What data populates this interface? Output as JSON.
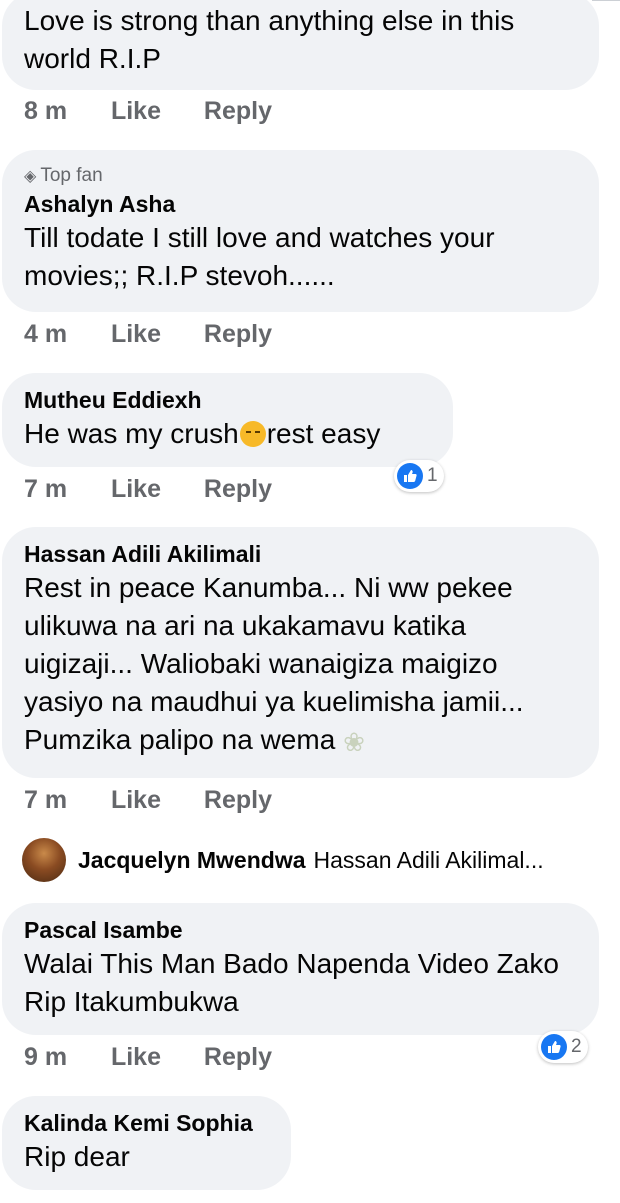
{
  "comments": [
    {
      "text": "Love is strong than anything else in this world R.I.P",
      "time": "8 m",
      "like": "Like",
      "reply": "Reply"
    },
    {
      "badge": "Top fan",
      "name": "Ashalyn Asha",
      "text": "Till todate I still love and watches your movies;; R.I.P stevoh......",
      "time": "4 m",
      "like": "Like",
      "reply": "Reply"
    },
    {
      "name": "Mutheu Eddiexh",
      "text_before": "He was my crush",
      "text_after": "rest easy",
      "time": "7 m",
      "like": "Like",
      "reply": "Reply",
      "reaction_count": "1"
    },
    {
      "name": "Hassan Adili Akilimali",
      "text": "Rest in peace Kanumba... Ni ww pekee ulikuwa na ari na ukakamavu katika uigizaji... Waliobaki wanaigiza maigizo yasiyo na maudhui ya kuelimisha jamii... Pumzika palipo na wema",
      "time": "7 m",
      "like": "Like",
      "reply": "Reply"
    },
    {
      "name": "Pascal Isambe",
      "text": "Walai This Man Bado Napenda Video Zako Rip Itakumbukwa",
      "time": "9 m",
      "like": "Like",
      "reply": "Reply",
      "reaction_count": "2"
    },
    {
      "name": "Kalinda Kemi Sophia",
      "text": "Rip dear"
    }
  ],
  "reply_preview": {
    "name": "Jacquelyn Mwendwa",
    "text": "Hassan Adili Akilimal..."
  },
  "icons": {
    "top_fan": "diamond-icon",
    "reaction": "like-icon",
    "emoji": "sleepy-face-emoji",
    "dove": "dove-emoji"
  },
  "colors": {
    "bubble": "#f0f2f5",
    "meta": "#65676b",
    "like_blue": "#1877f2"
  }
}
